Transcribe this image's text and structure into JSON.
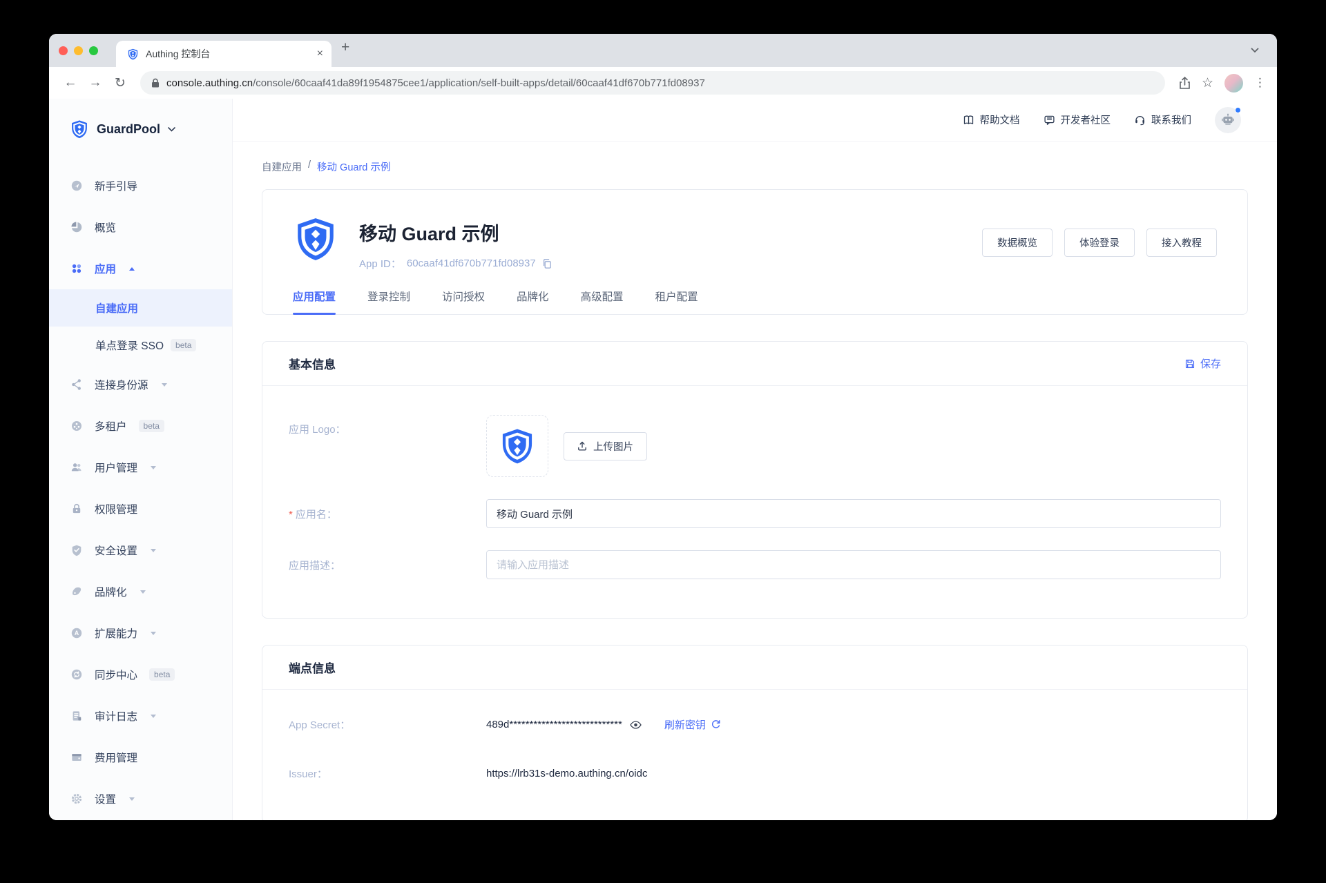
{
  "browser": {
    "tab_title": "Authing 控制台",
    "url_domain": "console.authing.cn",
    "url_path": "/console/60caaf41da89f1954875cee1/application/self-built-apps/detail/60caaf41df670b771fd08937",
    "icons": {
      "back": "←",
      "forward": "→",
      "reload": "↻",
      "close_tab": "×",
      "new_tab": "+",
      "star": "☆",
      "more": "⋮"
    }
  },
  "topbar": {
    "links": [
      "帮助文档",
      "开发者社区",
      "联系我们"
    ]
  },
  "sidebar": {
    "workspace": "GuardPool",
    "items": [
      {
        "label": "新手引导"
      },
      {
        "label": "概览"
      },
      {
        "label": "应用"
      },
      {
        "label": "自建应用"
      },
      {
        "label": "单点登录 SSO",
        "badge": "beta"
      },
      {
        "label": "连接身份源"
      },
      {
        "label": "多租户",
        "badge": "beta"
      },
      {
        "label": "用户管理"
      },
      {
        "label": "权限管理"
      },
      {
        "label": "安全设置"
      },
      {
        "label": "品牌化"
      },
      {
        "label": "扩展能力"
      },
      {
        "label": "同步中心",
        "badge": "beta"
      },
      {
        "label": "审计日志"
      },
      {
        "label": "费用管理"
      },
      {
        "label": "设置"
      }
    ]
  },
  "page": {
    "breadcrumb": {
      "parent": "自建应用",
      "separator": "/",
      "current": "移动 Guard 示例"
    },
    "app_header": {
      "title": "移动 Guard 示例",
      "app_id_label": "App ID：",
      "app_id": "60caaf41df670b771fd08937",
      "actions": [
        "数据概览",
        "体验登录",
        "接入教程"
      ]
    },
    "tabs": [
      "应用配置",
      "登录控制",
      "访问授权",
      "品牌化",
      "高级配置",
      "租户配置"
    ],
    "basic_info": {
      "title": "基本信息",
      "save_label": "保存",
      "logo_label": "应用 Logo：",
      "upload_label": "上传图片",
      "name_label": "应用名：",
      "name_value": "移动 Guard 示例",
      "desc_label": "应用描述：",
      "desc_placeholder": "请输入应用描述"
    },
    "endpoint_info": {
      "title": "端点信息",
      "app_secret_label": "App Secret：",
      "app_secret_value": "489d****************************",
      "refresh_label": "刷新密钥",
      "issuer_label": "Issuer：",
      "issuer_value": "https://lrb31s-demo.authing.cn/oidc"
    }
  },
  "colors": {
    "accent": "#4a6cf7",
    "brand_shield": "#2f6bf3",
    "danger": "#f05b4f"
  }
}
